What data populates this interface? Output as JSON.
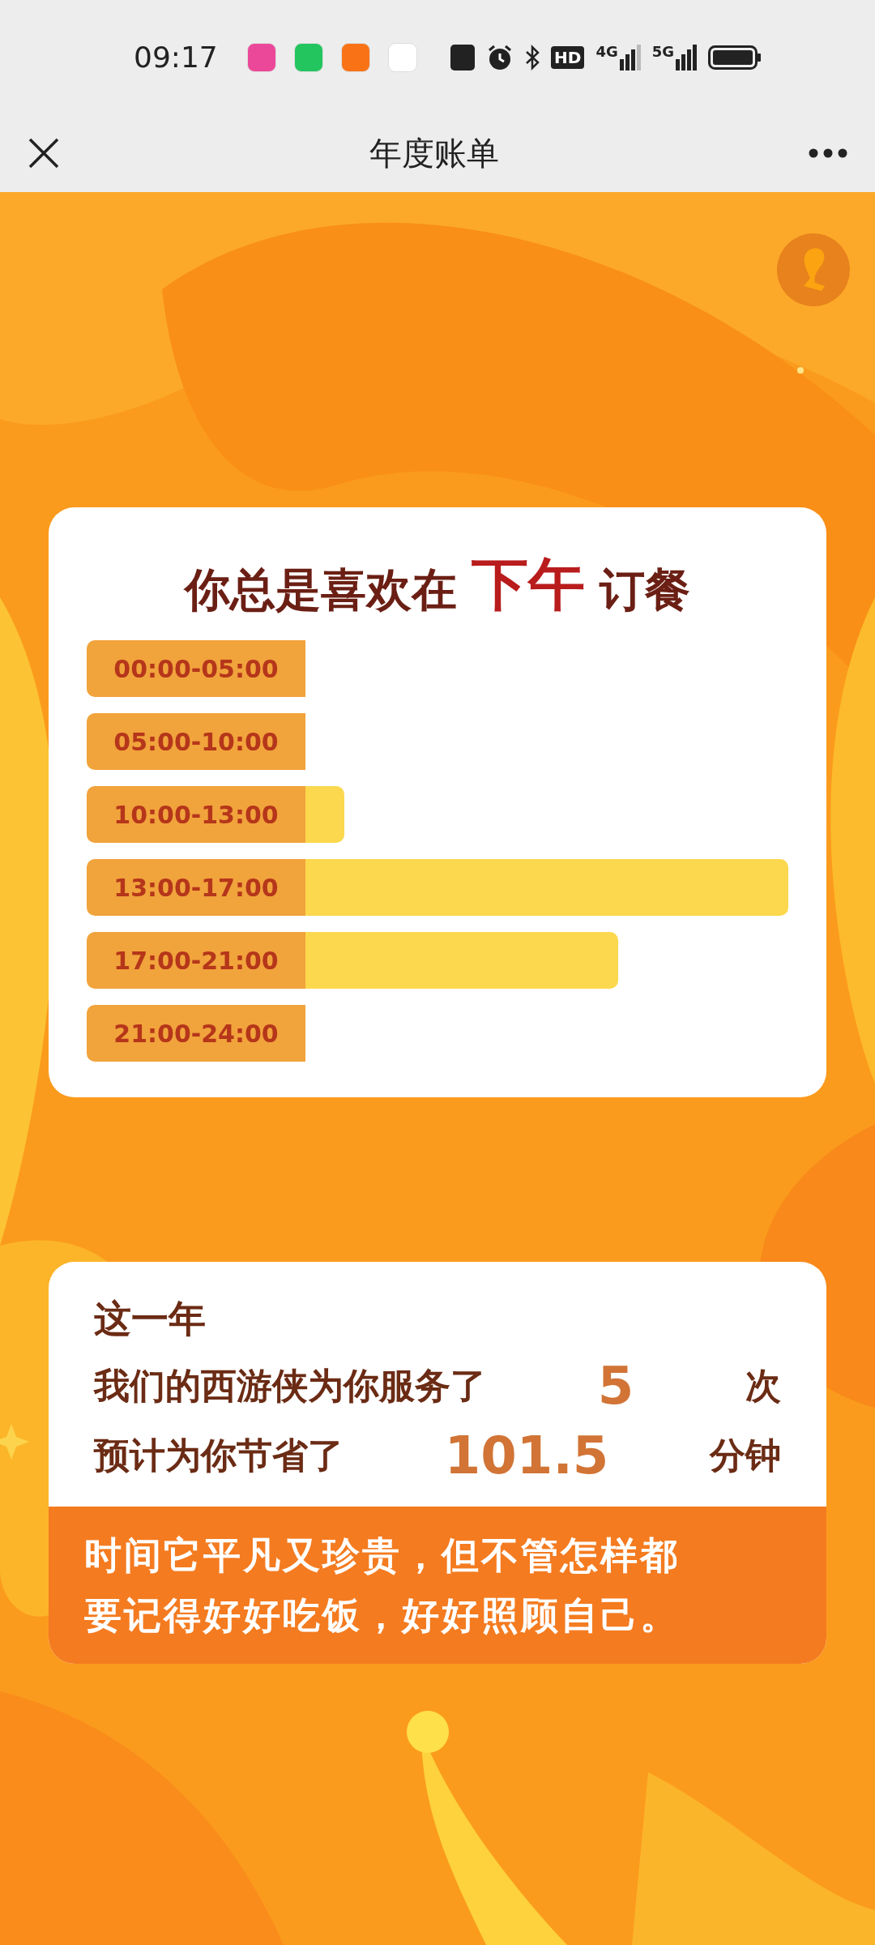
{
  "status_bar": {
    "time": "09:17",
    "hd_label": "HD",
    "network_4g": "4G",
    "network_5g": "5G"
  },
  "nav_bar": {
    "title": "年度账单"
  },
  "time_card": {
    "title_before": "你总是喜欢在",
    "title_highlight": "下午",
    "title_after": "订餐",
    "rows": [
      {
        "label": "00:00-05:00"
      },
      {
        "label": "05:00-10:00"
      },
      {
        "label": "10:00-13:00"
      },
      {
        "label": "13:00-17:00"
      },
      {
        "label": "17:00-21:00"
      },
      {
        "label": "21:00-24:00"
      }
    ]
  },
  "summary_card": {
    "heading": "这一年",
    "lines": [
      {
        "before": "我们的西游侠为你服务了",
        "value": "5",
        "after": "次"
      },
      {
        "before": "预计为你节省了",
        "value": "101.5",
        "after": "分钟"
      }
    ],
    "message": [
      "时间它平凡又珍贵，但不管怎样都",
      "要记得好好吃饭，好好照顾自己。"
    ]
  }
}
